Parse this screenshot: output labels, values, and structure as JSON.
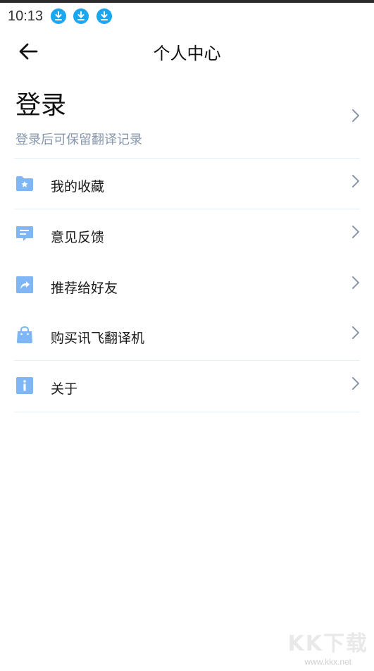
{
  "status_bar": {
    "time": "10:13",
    "notification_icons": [
      "download-icon",
      "download-icon",
      "download-icon"
    ],
    "accent": "#1aa7f2"
  },
  "header": {
    "title": "个人中心",
    "back_icon": "arrow-left-icon"
  },
  "login": {
    "title": "登录",
    "subtitle": "登录后可保留翻译记录"
  },
  "menu": [
    {
      "label": "我的收藏",
      "icon": "folder-star-icon"
    },
    {
      "label": "意见反馈",
      "icon": "message-icon"
    },
    {
      "label": "推荐给好友",
      "icon": "share-icon"
    },
    {
      "label": "购买讯飞翻译机",
      "icon": "shopping-bag-icon"
    },
    {
      "label": "关于",
      "icon": "info-icon"
    }
  ],
  "colors": {
    "icon_blue": "#7fb6f5",
    "subtitle": "#8797ad",
    "divider": "#e6edf3",
    "chevron": "#8a98aa"
  },
  "watermark": {
    "main": "KK下载",
    "url": "www.kkx.net"
  }
}
